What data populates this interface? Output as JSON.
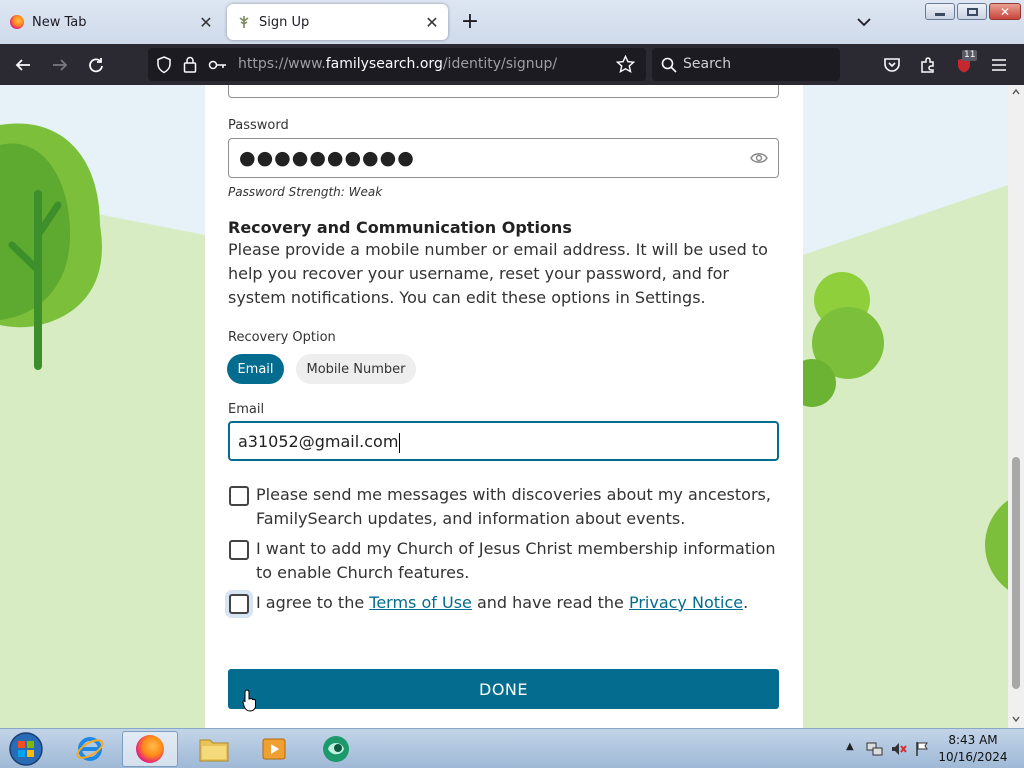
{
  "tabs": [
    {
      "title": "New Tab",
      "favicon": "firefox-icon",
      "active": false
    },
    {
      "title": "Sign Up",
      "favicon": "familysearch-tree-icon",
      "active": true
    }
  ],
  "toolbar": {
    "url_prefix": "https://www.",
    "url_host": "familysearch.org",
    "url_path": "/identity/signup/",
    "search_placeholder": "Search",
    "extension_badge": "11"
  },
  "form": {
    "password_label": "Password",
    "password_value": "●●●●●●●●●●",
    "password_strength": "Password Strength: Weak",
    "recovery_heading": "Recovery and Communication Options",
    "recovery_description": "Please provide a mobile number or email address. It will be used to help you recover your username, reset your password, and for system notifications. You can edit these options in Settings.",
    "recovery_option_label": "Recovery Option",
    "options": {
      "email": "Email",
      "mobile": "Mobile Number",
      "selected": "Email"
    },
    "email_label": "Email",
    "email_value": "a31052@gmail.com",
    "checkbox_discoveries": "Please send me messages with discoveries about my ancestors, FamilySearch updates, and information about events.",
    "checkbox_church": "I want to add my Church of Jesus Christ membership information to enable Church features.",
    "agree_prefix": "I agree to the",
    "terms_link": "Terms of Use",
    "agree_middle": "and have read the",
    "privacy_link": "Privacy Notice",
    "agree_suffix": ".",
    "done_label": "DONE"
  },
  "taskbar": {
    "time": "8:43 AM",
    "date": "10/16/2024"
  },
  "colors": {
    "accent": "#046c8e",
    "tree_green": "#7cbf3a",
    "hill_green": "#d8ecc4"
  }
}
